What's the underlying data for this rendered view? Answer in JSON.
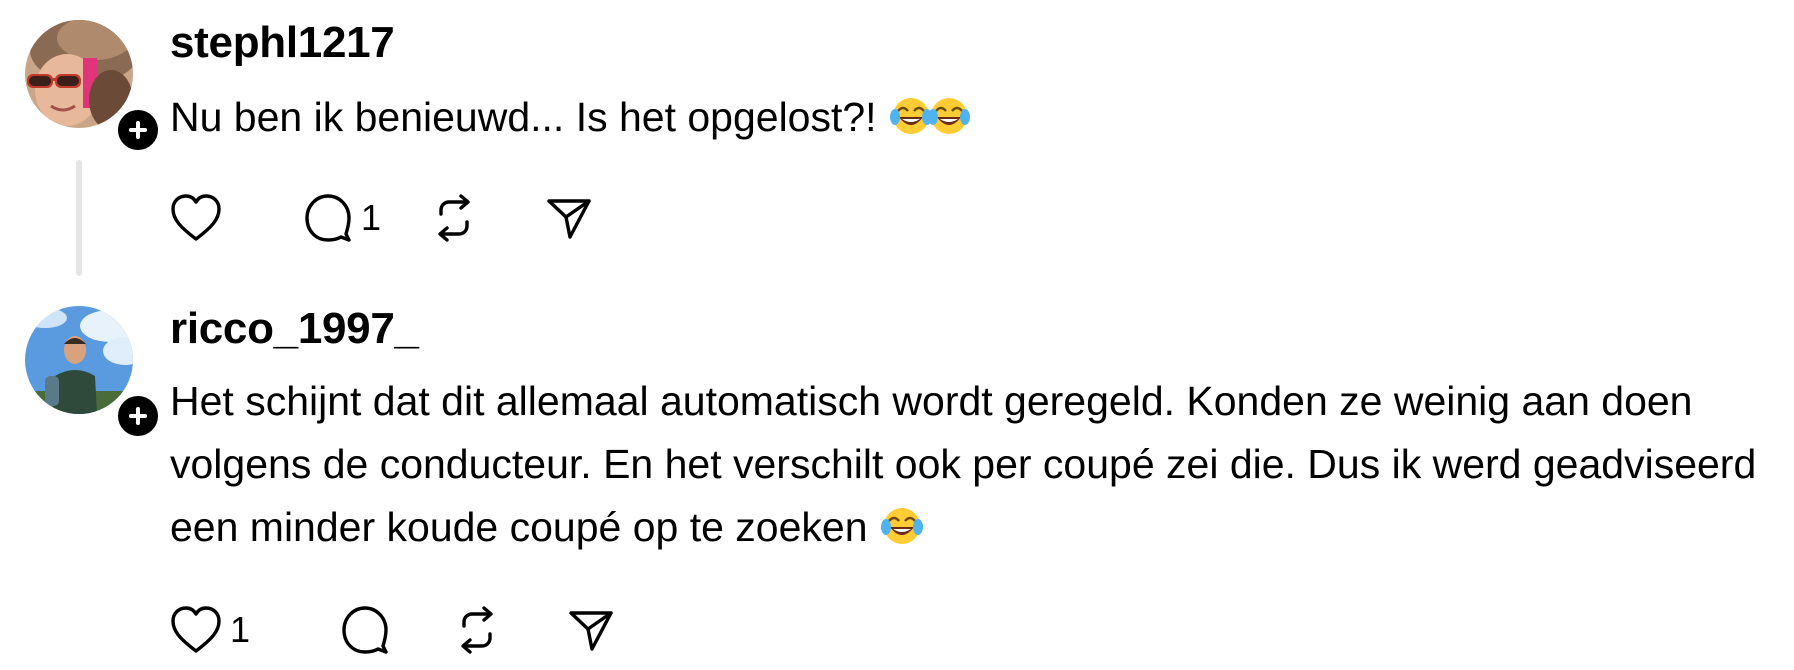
{
  "posts": [
    {
      "username": "stephl1217",
      "text": "Nu ben ik benieuwd... Is het opgelost?!",
      "emoji": [
        "face-with-tears-of-joy",
        "face-with-tears-of-joy"
      ],
      "likes": "",
      "replies": "1"
    },
    {
      "username": "ricco_1997_",
      "text": "Het schijnt dat dit allemaal automatisch wordt geregeld. Konden ze weinig aan doen volgens de conducteur. En het verschilt ook per coupé zei die. Dus ik werd geadviseerd een minder koude coupé op te zoeken",
      "emoji": [
        "face-with-tears-of-joy"
      ],
      "likes": "1",
      "replies": ""
    }
  ],
  "icons": {
    "like": "heart-icon",
    "reply": "speech-bubble-icon",
    "repost": "repost-arrows-icon",
    "share": "paper-plane-icon",
    "follow": "plus-icon"
  },
  "colors": {
    "background": "#ffffff",
    "text": "#000000",
    "thread_line": "#e5e5e5",
    "follow_badge": "#000000"
  }
}
